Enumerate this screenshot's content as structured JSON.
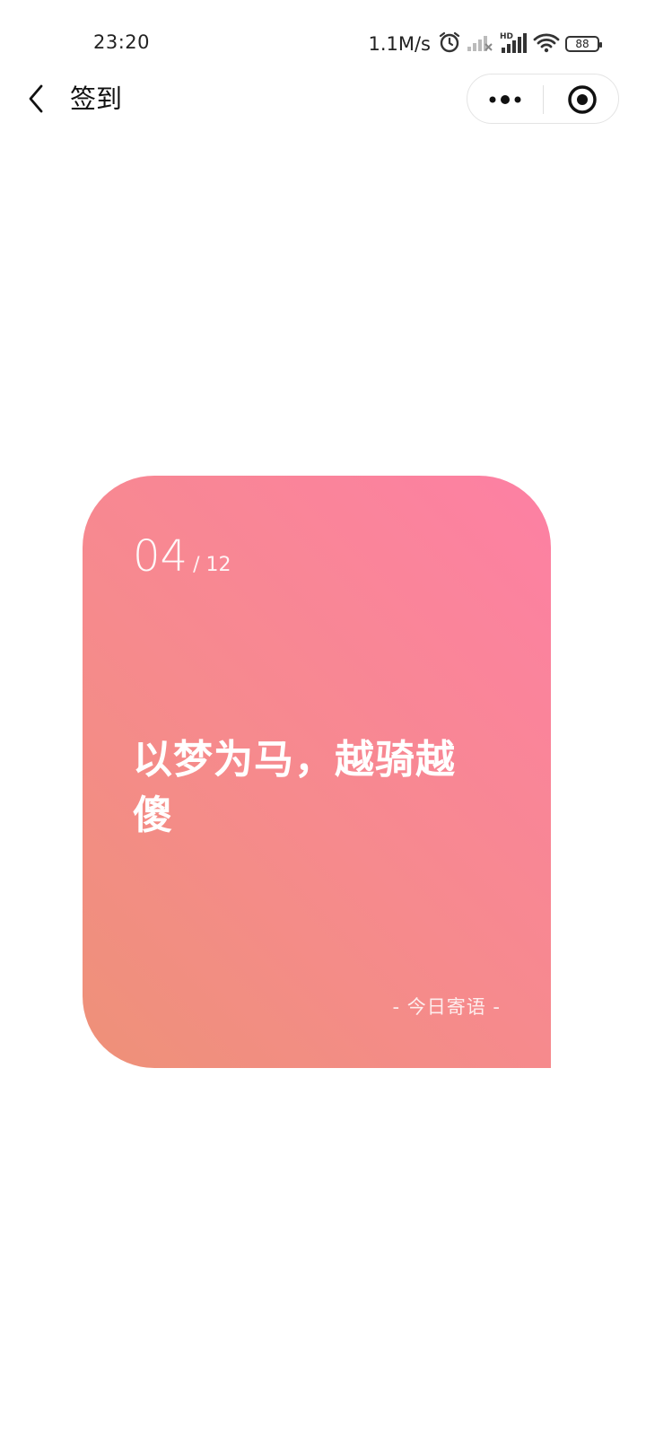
{
  "status": {
    "time": "23:20",
    "net_speed": "1.1M/s",
    "battery": "88",
    "signal_label": "HD"
  },
  "nav": {
    "title": "签到"
  },
  "card": {
    "day": "04",
    "month": "/ 12",
    "quote": "以梦为马，越骑越傻",
    "caption": "- 今日寄语 -",
    "gradient_start": "#ee9178",
    "gradient_end": "#fd80a4"
  }
}
